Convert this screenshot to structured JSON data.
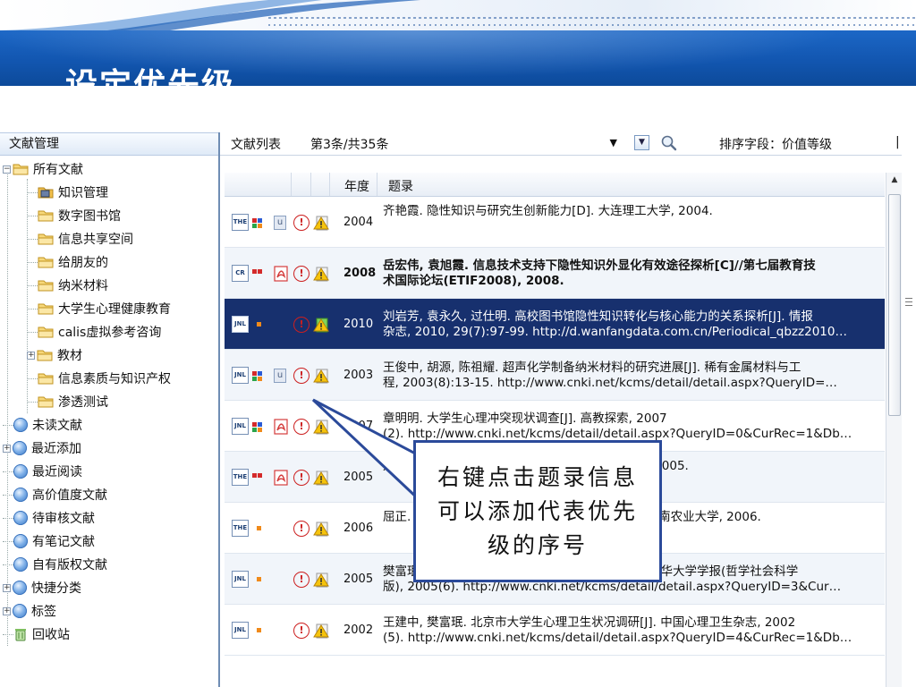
{
  "slide": {
    "title": "设定优先级"
  },
  "left_panel": {
    "header": "文献管理",
    "tree": [
      {
        "label": "所有文献",
        "icon": "folder-icon",
        "expander": "−"
      },
      {
        "label": "知识管理",
        "icon": "folder-special-icon"
      },
      {
        "label": "数字图书馆",
        "icon": "folder-icon"
      },
      {
        "label": "信息共享空间",
        "icon": "folder-icon"
      },
      {
        "label": "给朋友的",
        "icon": "folder-icon"
      },
      {
        "label": "纳米材料",
        "icon": "folder-icon"
      },
      {
        "label": "大学生心理健康教育",
        "icon": "folder-icon"
      },
      {
        "label": "calis虚拟参考咨询",
        "icon": "folder-icon"
      },
      {
        "label": "教材",
        "icon": "folder-icon",
        "expander": "+"
      },
      {
        "label": "信息素质与知识产权",
        "icon": "folder-icon"
      },
      {
        "label": "渗透测试",
        "icon": "folder-icon"
      },
      {
        "label": "未读文献",
        "icon": "orb-icon"
      },
      {
        "label": "最近添加",
        "icon": "orb-icon",
        "expander": "+"
      },
      {
        "label": "最近阅读",
        "icon": "orb-icon"
      },
      {
        "label": "高价值度文献",
        "icon": "orb-icon"
      },
      {
        "label": "待审核文献",
        "icon": "orb-icon"
      },
      {
        "label": "有笔记文献",
        "icon": "orb-icon"
      },
      {
        "label": "自有版权文献",
        "icon": "orb-icon"
      },
      {
        "label": "快捷分类",
        "icon": "orb-icon",
        "expander": "+"
      },
      {
        "label": "标签",
        "icon": "orb-icon",
        "expander": "+"
      },
      {
        "label": "回收站",
        "icon": "recycle-bin-icon"
      }
    ]
  },
  "toolbar": {
    "list_label": "文献列表",
    "position": "第3条/共35条",
    "select_arrow": "▼",
    "dropdown_btn": "▼",
    "sort_label": "排序字段：价值等级",
    "divider": "|"
  },
  "columns": {
    "year": "年度",
    "title": "题录"
  },
  "scroll": {
    "up": "▲"
  },
  "accent_colors": {
    "selected_row": "#17306e",
    "header_band": "#1256b0",
    "callout_border": "#2b4a9a"
  },
  "records": [
    {
      "type": "THE",
      "u": "u",
      "pdf": false,
      "imp": "!",
      "year": "2004",
      "line1": "齐艳霞. 隐性知识与研究生创新能力[D]. 大连理工大学, 2004.",
      "line2": ""
    },
    {
      "type": "CR",
      "u": "",
      "pdf": true,
      "imp": "!",
      "year": "2008",
      "line1": "岳宏伟, 袁旭霞. 信息技术支持下隐性知识外显化有效途径探析[C]//第七届教育技",
      "line2": "术国际论坛(ETIF2008), 2008."
    },
    {
      "type": "JNL",
      "u": "",
      "pdf": false,
      "imp": "!",
      "year": "2010",
      "line1": "刘岩芳, 袁永久, 过仕明. 高校图书馆隐性知识转化与核心能力的关系探析[J]. 情报",
      "line2": "杂志, 2010, 29(7):97-99. http://d.wanfangdata.com.cn/Periodical_qbzz2010…"
    },
    {
      "type": "JNL",
      "u": "u",
      "pdf": false,
      "imp": "!",
      "year": "2003",
      "line1": "王俊中, 胡源, 陈祖耀. 超声化学制备纳米材料的研究进展[J]. 稀有金属材料与工",
      "line2": "程, 2003(8):13-15. http://www.cnki.net/kcms/detail/detail.aspx?QueryID=…"
    },
    {
      "type": "JNL",
      "u": "",
      "pdf": true,
      "imp": "!",
      "year": "2007",
      "line1": "章明明. 大学生心理冲突现状调查[J]. 高教探索, 2007",
      "line2": "(2). http://www.cnki.net/kcms/detail/detail.aspx?QueryID=0&CurRec=1&Db…"
    },
    {
      "type": "THE",
      "u": "",
      "pdf": true,
      "imp": "!",
      "year": "2005",
      "line1": "龙彬. 大学生心理健康教育研究[D]. 武汉理工大学, 2005.",
      "line2": ""
    },
    {
      "type": "THE",
      "u": "",
      "pdf": false,
      "imp": "!",
      "year": "2006",
      "line1": "屈正. 大学生心理健康问题的成因与对策研究[D]. 湖南农业大学, 2006.",
      "line2": ""
    },
    {
      "type": "JNL",
      "u": "",
      "pdf": false,
      "imp": "!",
      "year": "2005",
      "line1": "樊富珉. 我国团体心理咨询的发展: 回顾与展望[J]. 清华大学学报(哲学社会科学",
      "line2": "版), 2005(6). http://www.cnki.net/kcms/detail/detail.aspx?QueryID=3&Cur…"
    },
    {
      "type": "JNL",
      "u": "",
      "pdf": false,
      "imp": "!",
      "year": "2002",
      "line1": "王建中, 樊富珉. 北京市大学生心理卫生状况调研[J]. 中国心理卫生杂志, 2002",
      "line2": "(5). http://www.cnki.net/kcms/detail/detail.aspx?QueryID=4&CurRec=1&Db…"
    }
  ],
  "callout": {
    "text": "右键点击题录信息可以添加代表优先级的序号"
  }
}
